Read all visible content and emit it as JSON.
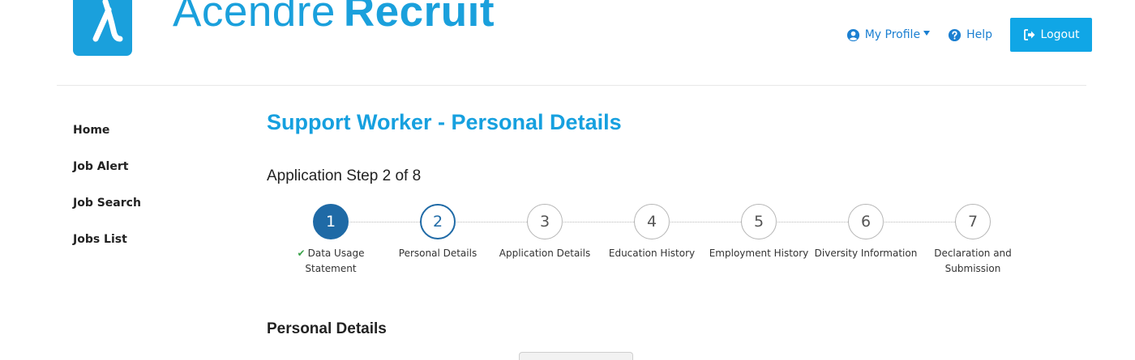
{
  "header": {
    "logo_light": "Acendre",
    "logo_bold": "Recruit",
    "brand_color": "#1aa0dc",
    "nav": {
      "profile_label": "My Profile",
      "help_label": "Help",
      "logout_label": "Logout"
    }
  },
  "sidebar": {
    "items": [
      {
        "label": "Home"
      },
      {
        "label": "Job Alert"
      },
      {
        "label": "Job Search"
      },
      {
        "label": "Jobs List"
      }
    ]
  },
  "main": {
    "title": "Support Worker - Personal Details",
    "step_text": "Application Step 2 of 8",
    "steps": [
      {
        "number": "1",
        "caption": "Data Usage Statement",
        "state": "done"
      },
      {
        "number": "2",
        "caption": "Personal Details",
        "state": "active"
      },
      {
        "number": "3",
        "caption": "Application Details",
        "state": "pending"
      },
      {
        "number": "4",
        "caption": "Education History",
        "state": "pending"
      },
      {
        "number": "5",
        "caption": "Employment History",
        "state": "pending"
      },
      {
        "number": "6",
        "caption": "Diversity Information",
        "state": "pending"
      },
      {
        "number": "7",
        "caption": "Declaration and Submission",
        "state": "pending"
      }
    ],
    "section_title": "Personal Details"
  }
}
